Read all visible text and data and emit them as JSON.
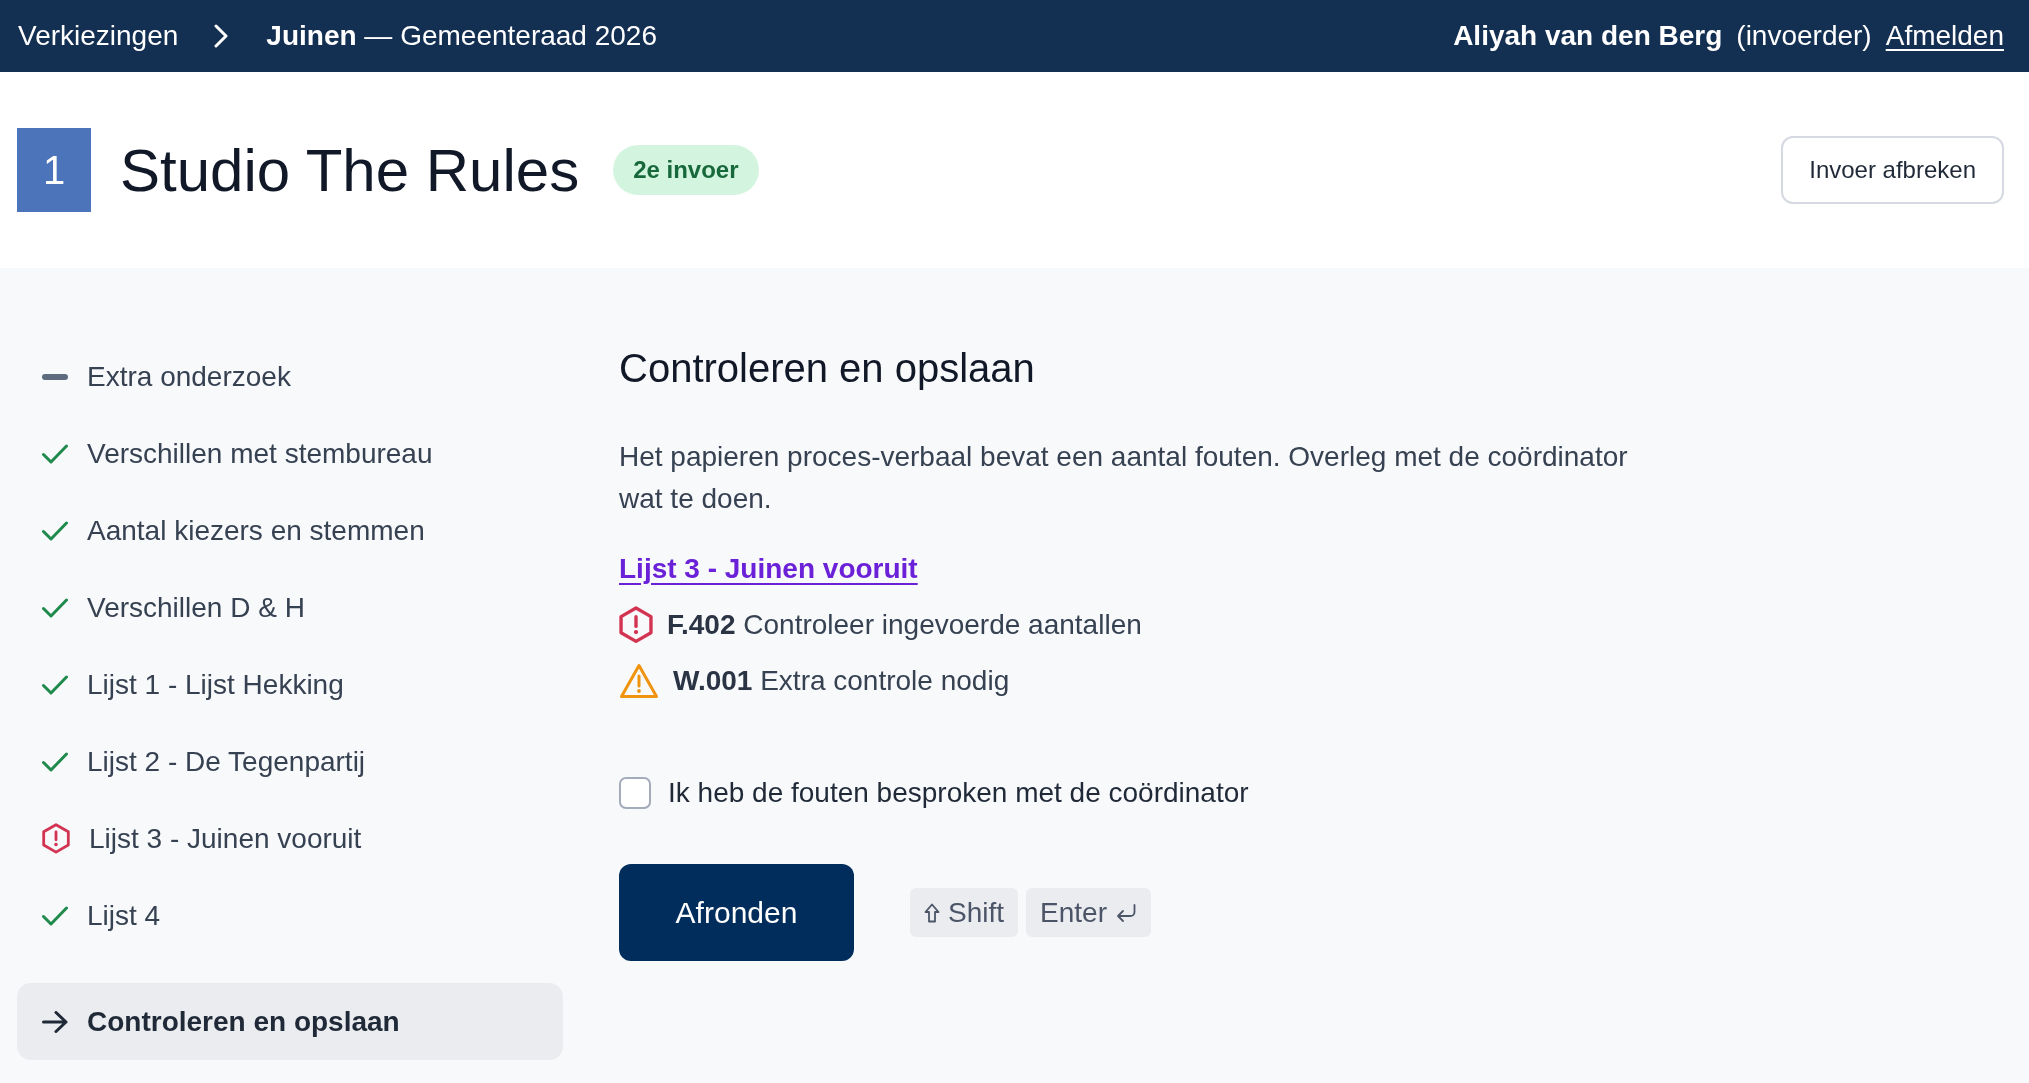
{
  "top_bar": {
    "breadcrumb": "Verkiezingen",
    "election": "**Juinen** — Gemeenteraad 2026",
    "user": {
      "name": "Aliyah van den Berg",
      "role": "(invoerder)",
      "logout": "Afmelden"
    }
  },
  "header": {
    "number": "1",
    "title": "Studio The Rules",
    "badge": "2e invoer",
    "abort_button": "Invoer afbreken"
  },
  "sidebar": {
    "items": [
      {
        "label": "Extra onderzoek",
        "kind": "empty",
        "selected": false
      },
      {
        "label": "Verschillen met stembureau",
        "kind": "done",
        "selected": false
      },
      {
        "label": "Aantal kiezers en stemmen",
        "kind": "done",
        "selected": false
      },
      {
        "label": "Verschillen D & H",
        "kind": "done",
        "selected": false
      },
      {
        "label": "Lijst 1 - Lijst Hekking",
        "kind": "done",
        "selected": false
      },
      {
        "label": "Lijst 2 - De Tegenpartij",
        "kind": "done",
        "selected": false
      },
      {
        "label": "Lijst 3 - Juinen vooruit",
        "kind": "error",
        "selected": false
      },
      {
        "label": "Lijst 4",
        "kind": "done",
        "selected": false
      },
      {
        "label": "Controleren en opslaan",
        "kind": "current",
        "selected": true
      }
    ]
  },
  "main": {
    "heading": "Controleren en opslaan",
    "intro": "Het papieren proces-verbaal bevat een aantal fouten. Overleg met de coördinator wat te doen.",
    "section_link": "Lijst 3 - Juinen vooruit",
    "messages": [
      {
        "kind": "error",
        "text": "**F.402** Controleer ingevoerde aantallen"
      },
      {
        "kind": "warning",
        "text": "**W.001** Extra controle nodig"
      }
    ],
    "confirm": {
      "label": "Ik heb de fouten besproken met de coördinator",
      "checked": false
    },
    "submit_button": "Afronden",
    "shortcut": [
      {
        "kind": "shift",
        "label": "Shift"
      },
      {
        "kind": "enter",
        "label": "Enter"
      }
    ]
  }
}
